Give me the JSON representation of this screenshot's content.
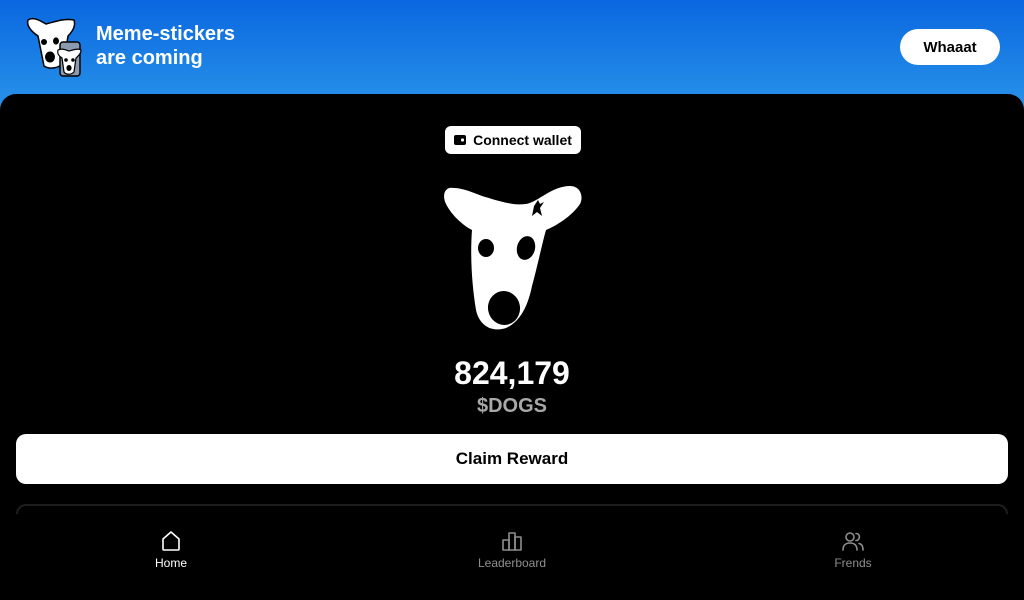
{
  "banner": {
    "title_line1": "Meme-stickers",
    "title_line2": "are coming",
    "action_label": "Whaaat"
  },
  "main": {
    "connect_wallet_label": "Connect wallet",
    "balance": "824,179",
    "ticker": "$DOGS",
    "claim_label": "Claim Reward"
  },
  "nav": {
    "items": [
      {
        "label": "Home",
        "icon": "home-icon",
        "active": true
      },
      {
        "label": "Leaderboard",
        "icon": "leaderboard-icon",
        "active": false
      },
      {
        "label": "Frends",
        "icon": "friends-icon",
        "active": false
      }
    ]
  },
  "colors": {
    "banner_top": "#0a67e0",
    "banner_bottom": "#2a93ea",
    "background": "#000000",
    "muted": "#8e8e8e"
  }
}
